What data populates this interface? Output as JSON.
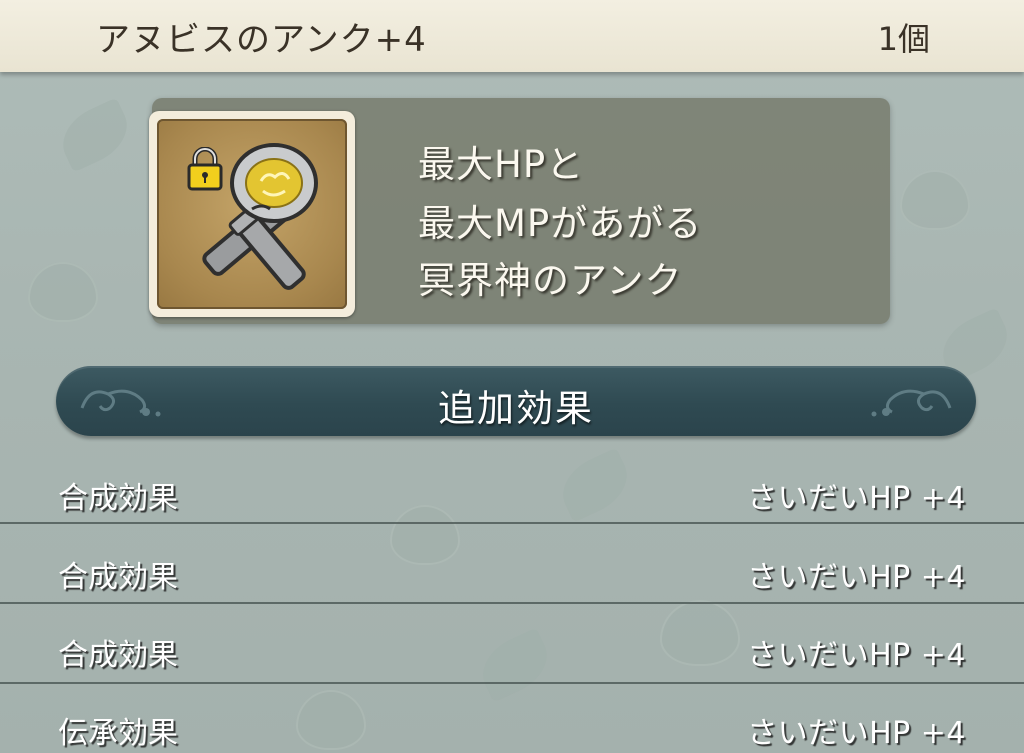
{
  "header": {
    "title": "アヌビスのアンク+4",
    "count": "1個"
  },
  "item": {
    "icon": "ankh-icon",
    "lock_icon": "lock-icon",
    "description": [
      "最大HPと",
      "最大MPがあがる",
      "冥界神のアンク"
    ]
  },
  "section": {
    "title": "追加効果"
  },
  "effects": [
    {
      "label": "合成効果",
      "value": "さいだいHP  +4"
    },
    {
      "label": "合成効果",
      "value": "さいだいHP  +4"
    },
    {
      "label": "合成効果",
      "value": "さいだいHP  +4"
    },
    {
      "label": "伝承効果",
      "value": "さいだいHP  +4"
    }
  ],
  "colors": {
    "header_bg": "#eee9d8",
    "banner_bg": "#33505a",
    "card_bg": "#6e7060",
    "background": "#aab8b4"
  }
}
